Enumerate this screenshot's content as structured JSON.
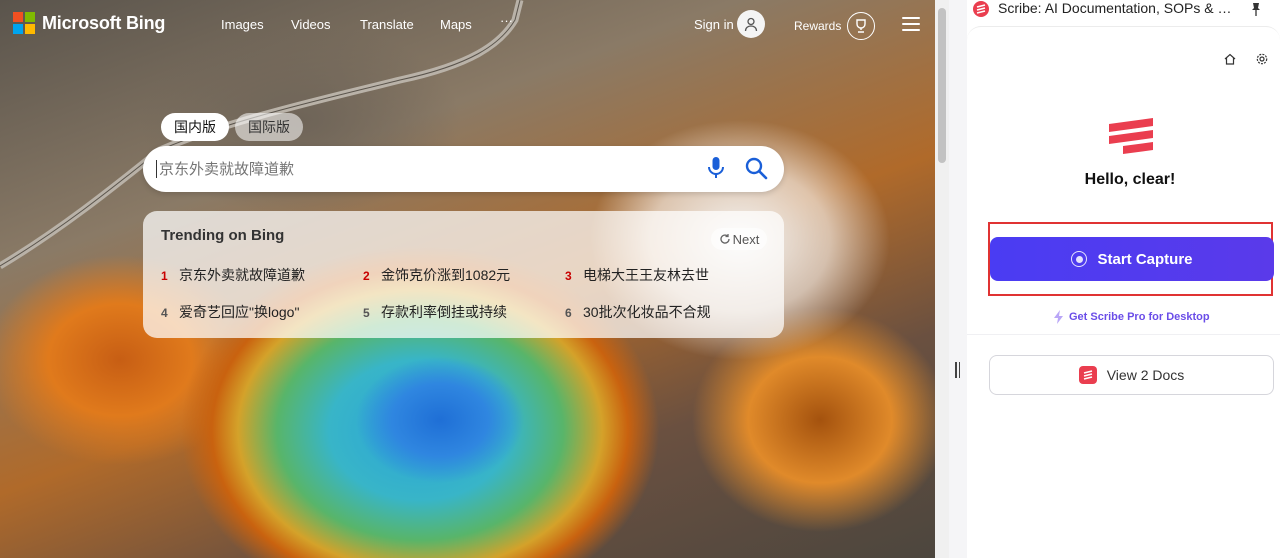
{
  "bing": {
    "logo_text": "Microsoft Bing",
    "nav": [
      "Images",
      "Videos",
      "Translate",
      "Maps",
      "···"
    ],
    "sign_in": "Sign in",
    "rewards": "Rewards",
    "tabs": [
      "国内版",
      "国际版"
    ],
    "active_tab": "国内版",
    "search": {
      "placeholder": "京东外卖就故障道歉"
    },
    "trending": {
      "title": "Trending on Bing",
      "next_label": "Next",
      "items": [
        {
          "rank": "1",
          "text": "京东外卖就故障道歉"
        },
        {
          "rank": "2",
          "text": "金饰克价涨到1082元"
        },
        {
          "rank": "3",
          "text": "电梯大王王友林去世"
        },
        {
          "rank": "4",
          "text": "爱奇艺回应\"换logo\""
        },
        {
          "rank": "5",
          "text": "存款利率倒挂或持续"
        },
        {
          "rank": "6",
          "text": "30批次化妆品不合规"
        }
      ]
    },
    "colors": {
      "ms_red": "#f25022",
      "ms_green": "#7fba00",
      "ms_blue": "#00a4ef",
      "ms_yellow": "#ffb900",
      "rank_red": "#c80000"
    }
  },
  "scribe": {
    "panel_title": "Scribe: AI Documentation, SOPs & Sc...",
    "greeting": "Hello, clear!",
    "capture_label": "Start Capture",
    "pro_link": "Get Scribe Pro for Desktop",
    "docs_label": "View 2 Docs",
    "colors": {
      "brand": "#ea3e4f",
      "capture": "#4a3cf3",
      "highlight": "#e03333"
    }
  }
}
